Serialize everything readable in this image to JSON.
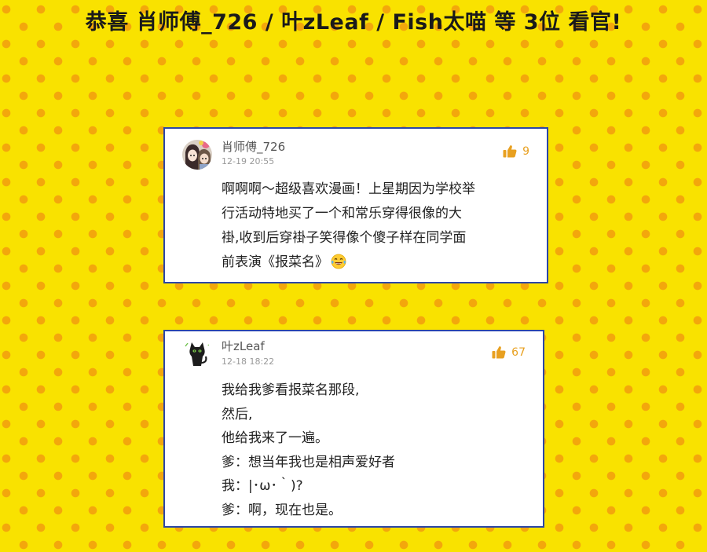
{
  "headline": "恭喜 肖师傅_726 / 叶zLeaf  / Fish太喵  等 3位 看官!",
  "colors": {
    "background": "#f9e200",
    "dots": "#f3a70c",
    "card_border": "#2b46a8",
    "like_accent": "#e8a020"
  },
  "comments": [
    {
      "username": "肖师傅_726",
      "timestamp": "12-19 20:55",
      "likes": "9",
      "avatar_icon": "anime-couple-avatar",
      "like_icon": "thumbs-up-icon",
      "lines": [
        "啊啊啊～超级喜欢漫画！上星期因为学校举",
        "行活动特地买了一个和常乐穿得很像的大",
        "褂,收到后穿褂子笑得像个傻子样在同学面",
        "前表演《报菜名》"
      ],
      "trailing_emoji": "laughing-tears-emoji"
    },
    {
      "username": "叶zLeaf",
      "timestamp": "12-18 18:22",
      "likes": "67",
      "avatar_icon": "black-cat-avatar",
      "like_icon": "thumbs-up-icon",
      "lines": [
        "我给我爹看报菜名那段,",
        "然后,",
        "他给我来了一遍。",
        "爹：想当年我也是相声爱好者",
        "我：|･ω･｀)?",
        "爹：啊，现在也是。"
      ]
    }
  ]
}
